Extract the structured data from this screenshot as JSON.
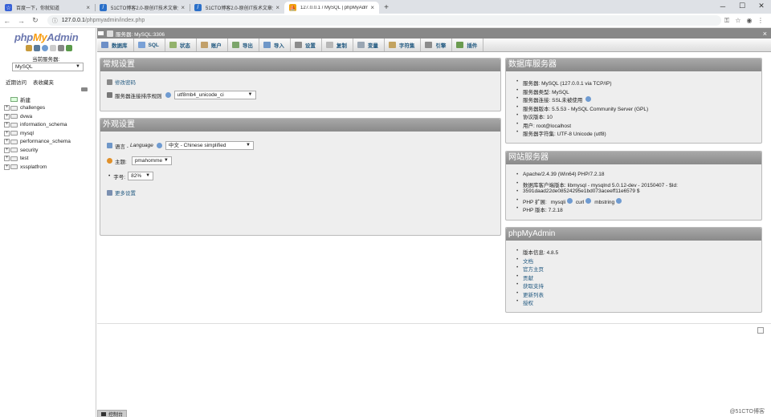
{
  "browser": {
    "tabs": [
      {
        "title": "百度一下，你就知道",
        "fav_color": "#3862d7",
        "fav_glyph": "☆"
      },
      {
        "title": "51CTO博客2.0-原创IT技术文章分享",
        "fav_color": "#2b70c9",
        "fav_glyph": "/"
      },
      {
        "title": "51CTO博客2.0-原创IT技术文章分享",
        "fav_color": "#2b70c9",
        "fav_glyph": "/"
      },
      {
        "title": "127.0.0.1 / MySQL | phpMyAdmin",
        "fav_color": "#f0a30a",
        "fav_glyph": "⛵"
      }
    ],
    "url_host": "127.0.0.1",
    "url_path": "/phpmyadmin/index.php"
  },
  "sidebar": {
    "logo_php": "php",
    "logo_my": "My",
    "logo_admin": "Admin",
    "server_label": "当前服务器:",
    "server_value": "MySQL",
    "recent": "近期访问",
    "favorites": "表收藏夹",
    "new": "新建",
    "databases": [
      "challenges",
      "dvwa",
      "information_schema",
      "mysql",
      "performance_schema",
      "security",
      "test",
      "xssplatfrom"
    ]
  },
  "main": {
    "server_crumb": "服务器: MySQL:3306",
    "menu": [
      {
        "label": "数据库",
        "color": "#6d8fc7"
      },
      {
        "label": "SQL",
        "color": "#7aa1d6"
      },
      {
        "label": "状态",
        "color": "#93b26b"
      },
      {
        "label": "账户",
        "color": "#c2a06a"
      },
      {
        "label": "导出",
        "color": "#7ca56b"
      },
      {
        "label": "导入",
        "color": "#6f97c8"
      },
      {
        "label": "设置",
        "color": "#8c8c8c"
      },
      {
        "label": "复制",
        "color": "#b7b7b7"
      },
      {
        "label": "变量",
        "color": "#9aa6b3"
      },
      {
        "label": "字符集",
        "color": "#c3a35f"
      },
      {
        "label": "引擎",
        "color": "#8c8c8c"
      },
      {
        "label": "插件",
        "color": "#6b9b4f"
      }
    ],
    "general": {
      "title": "常规设置",
      "change_password": "修改密码",
      "collation_label": "服务器连接排序规则",
      "collation_value": "utf8mb4_unicode_ci"
    },
    "appearance": {
      "title": "外观设置",
      "language_label": "语言 - ",
      "language_italic": "Language",
      "language_value": "中文 - Chinese simplified",
      "theme_label": "主题:",
      "theme_value": "pmahomme",
      "fontsize_label": "字号:",
      "fontsize_value": "82%",
      "more_settings": "更多设置"
    },
    "db_server": {
      "title": "数据库服务器",
      "items": [
        "服务器: MySQL (127.0.0.1 via TCP/IP)",
        "服务器类型: MySQL",
        "服务器连接: SSL未被使用",
        "服务器版本: 5.5.53 - MySQL Community Server (GPL)",
        "协议版本: 10",
        "用户: root@localhost",
        "服务器字符集: UTF-8 Unicode (utf8)"
      ]
    },
    "web_server": {
      "title": "网站服务器",
      "apache": "Apache/2.4.39 (Win64) PHP/7.2.18",
      "dbclient_1": "数据库客户端版本: libmysql - mysqlnd 5.0.12-dev - 20150407 - $Id:",
      "dbclient_2": "3591daad22de08524295e1bd073aceeff11e6579 $",
      "php_ext_label": "PHP 扩展:",
      "php_ext_1": "mysqli",
      "php_ext_2": "curl",
      "php_ext_3": "mbstring",
      "php_version": "PHP 版本: 7.2.18"
    },
    "pma": {
      "title": "phpMyAdmin",
      "version": "版本信息: 4.8.5",
      "links": [
        "文档",
        "官方主页",
        "贡献",
        "获取支持",
        "更新列表",
        "授权"
      ]
    },
    "console": "控制台",
    "watermark": "@51CTO博客"
  }
}
